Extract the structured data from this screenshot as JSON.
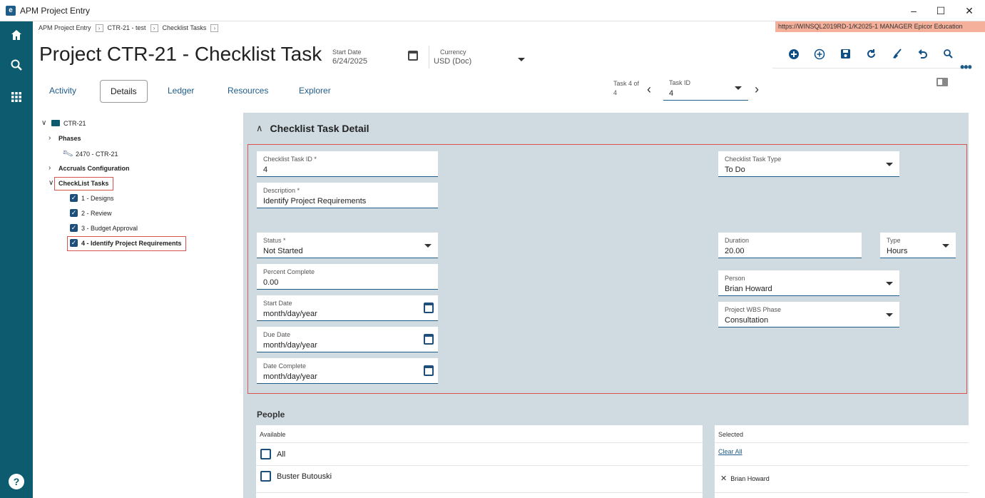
{
  "window": {
    "title": "APM Project Entry",
    "minimize": "–",
    "maximize": "☐",
    "close": "✕"
  },
  "breadcrumb": [
    "APM Project Entry",
    "CTR-21 - test",
    "Checklist Tasks"
  ],
  "server_info": "https://WINSQL2019RD-1/K2025-1   MANAGER   Epicor Education",
  "page_title": "Project CTR-21 - Checklist Task",
  "header": {
    "start_date_label": "Start Date",
    "start_date_value": "6/24/2025",
    "currency_label": "Currency",
    "currency_value": "USD (Doc)"
  },
  "toolbar_icons": [
    "add-circle-icon",
    "add-outline-icon",
    "save-icon",
    "refresh-icon",
    "clear-icon",
    "undo-icon",
    "search-icon"
  ],
  "tabs": [
    "Activity",
    "Details",
    "Ledger",
    "Resources",
    "Explorer"
  ],
  "active_tab": "Details",
  "task_nav": {
    "position_label": "Task 4 of",
    "position_total": "4",
    "task_id_label": "Task ID",
    "task_id_value": "4"
  },
  "tree": {
    "root": "CTR-21",
    "phases": "Phases",
    "phase_item": "2470 - CTR-21",
    "accruals": "Accruals Configuration",
    "checklist": "CheckList Tasks",
    "tasks": [
      "1 - Designs",
      "2 - Review",
      "3 - Budget Approval",
      "4 - Identify Project Requirements"
    ]
  },
  "detail": {
    "section_title": "Checklist Task Detail",
    "checklist_task_id": {
      "label": "Checklist Task ID *",
      "value": "4"
    },
    "description": {
      "label": "Description *",
      "value": "Identify Project Requirements"
    },
    "status": {
      "label": "Status *",
      "value": "Not Started"
    },
    "percent_complete": {
      "label": "Percent Complete",
      "value": "0.00"
    },
    "start_date": {
      "label": "Start Date",
      "value": "month/day/year"
    },
    "due_date": {
      "label": "Due Date",
      "value": "month/day/year"
    },
    "date_complete": {
      "label": "Date Complete",
      "value": "month/day/year"
    },
    "checklist_task_type": {
      "label": "Checklist Task Type",
      "value": "To Do"
    },
    "duration": {
      "label": "Duration",
      "value": "20.00"
    },
    "type": {
      "label": "Type",
      "value": "Hours"
    },
    "person": {
      "label": "Person",
      "value": "Brian Howard"
    },
    "wbs_phase": {
      "label": "Project WBS Phase",
      "value": "Consultation"
    }
  },
  "people": {
    "title": "People",
    "available_label": "Available",
    "available_items": [
      "All",
      "Buster Butouski"
    ],
    "selected_label": "Selected",
    "clear_all": "Clear All",
    "selected_items": [
      "Brian Howard"
    ]
  },
  "colors": {
    "sidebar": "#0c5b6e",
    "accent": "#1e5c8a",
    "panel_bg": "#cfdbe1",
    "highlight": "#d9534f",
    "server_bg": "#f4b09a"
  }
}
